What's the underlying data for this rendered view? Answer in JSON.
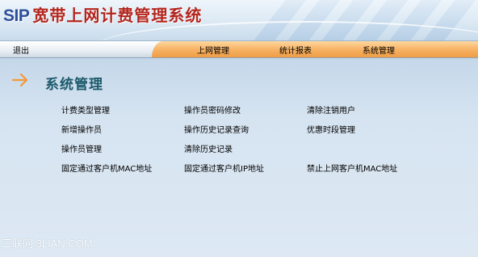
{
  "header": {
    "logo_prefix": "SIP",
    "logo_title": "宽带上网计费管理系统"
  },
  "nav": {
    "logout": "退出",
    "items": [
      "上网管理",
      "统计报表",
      "系统管理"
    ]
  },
  "page": {
    "title": "系统管理"
  },
  "menu": {
    "columns": [
      [
        "计费类型管理",
        "新增操作员",
        "操作员管理",
        "固定通过客户机MAC地址"
      ],
      [
        "操作员密码修改",
        "操作历史记录查询",
        "清除历史记录",
        "固定通过客户机IP地址"
      ],
      [
        "清除注销用户",
        "优惠时段管理",
        "",
        "禁止上网客户机MAC地址"
      ]
    ]
  },
  "watermark": "三联网 3LIAN.COM",
  "colors": {
    "logo_prefix": "#2e4f9a",
    "logo_title": "#b3261e",
    "nav_accent": "#f6b061",
    "title": "#1d5a6c",
    "arrow": "#f29a3a"
  },
  "icons": {
    "arrow": "arrow-right-icon"
  }
}
